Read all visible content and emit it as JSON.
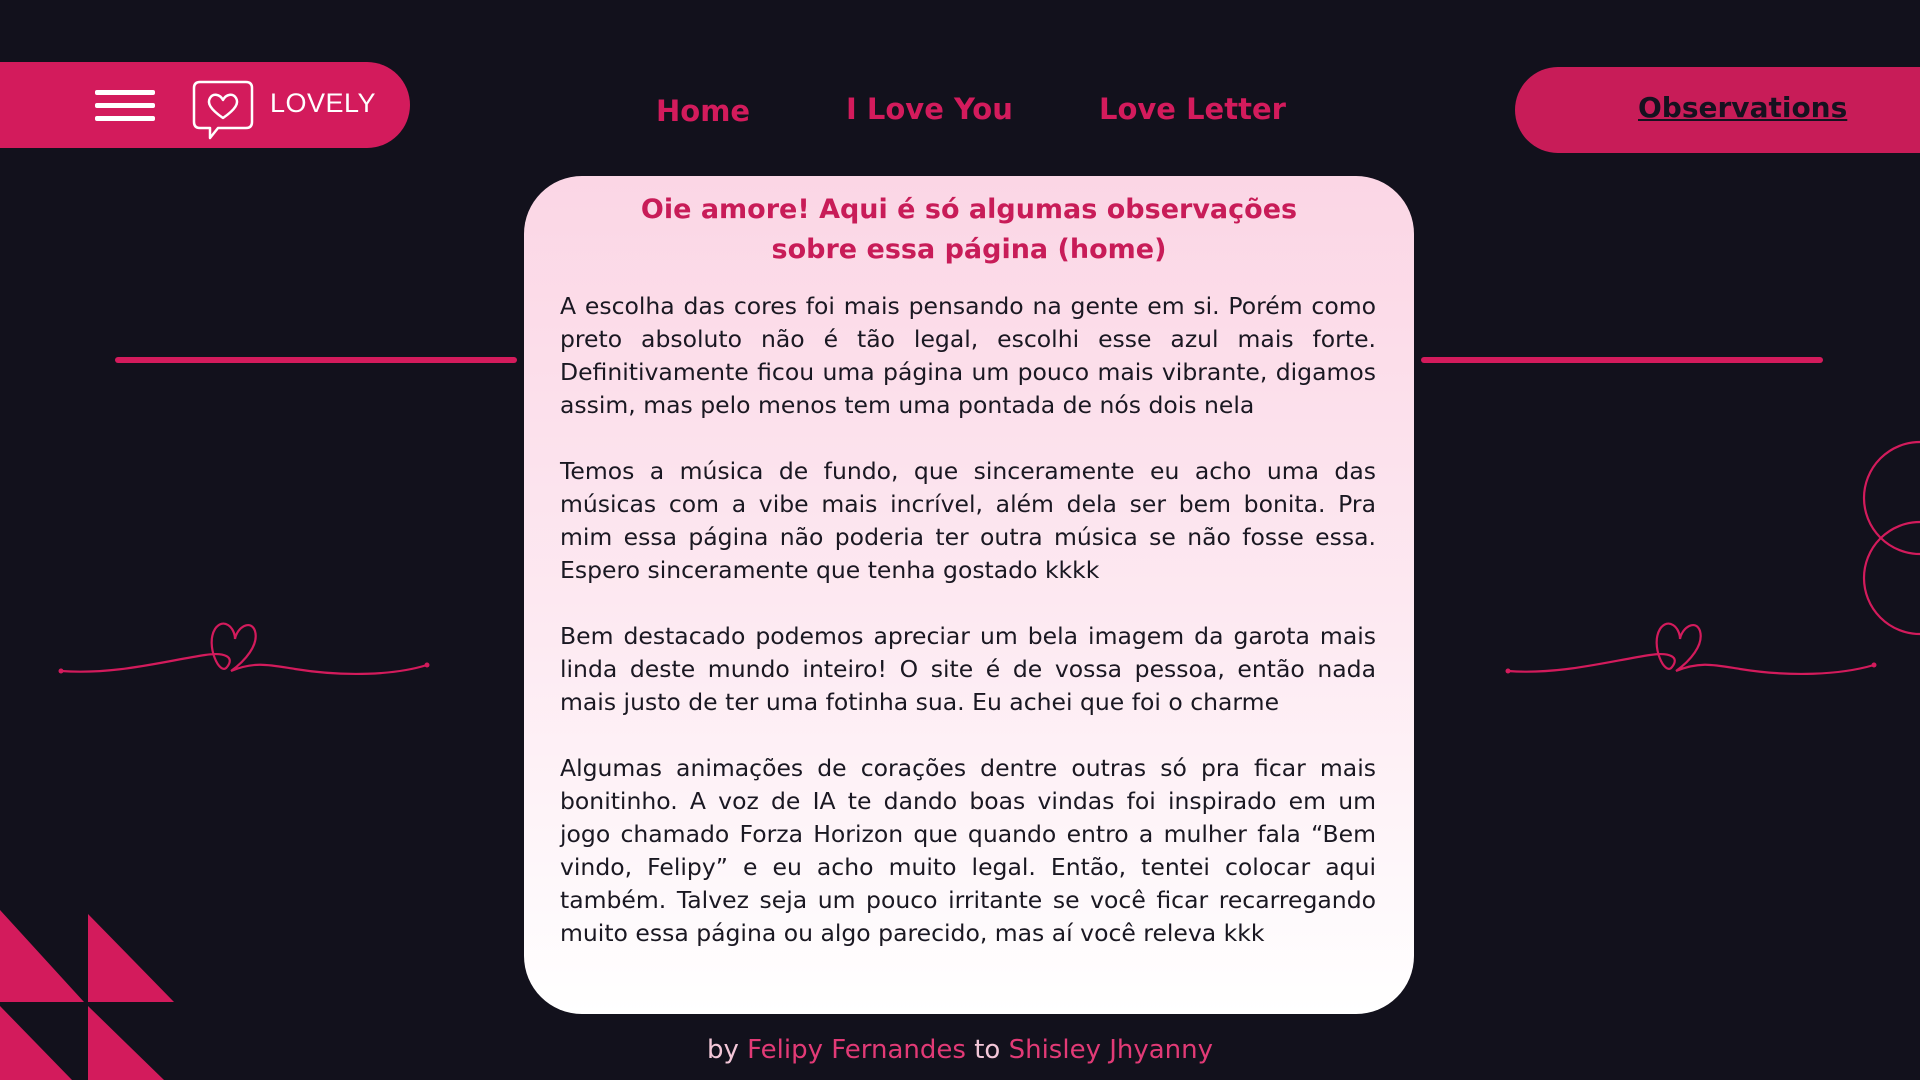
{
  "header": {
    "logo_text": "LOVELY",
    "menu_icon": "hamburger-menu-icon",
    "logo_icon": "heart-chat-bubble-icon"
  },
  "nav": {
    "home": "Home",
    "i_love_you": "I Love You",
    "love_letter": "Love Letter",
    "observations": "Observations"
  },
  "card": {
    "title_line1": "Oie amore! Aqui é só algumas observações",
    "title_line2": "sobre essa página (home)",
    "paragraphs": [
      "A escolha das cores foi mais pensando na gente em si. Porém como preto absoluto não é tão legal, escolhi esse azul mais forte. Definitivamente ficou uma página um pouco mais vibrante, digamos assim, mas pelo menos tem uma pontada de nós dois nela",
      "Temos a música de fundo, que sinceramente eu acho uma das músicas com a vibe mais incrível, além dela ser bem bonita. Pra mim essa página não poderia ter outra música se não fosse essa. Espero sinceramente que tenha gostado kkkk",
      "Bem destacado podemos apreciar um bela imagem da garota mais linda deste mundo inteiro! O site é de vossa pessoa, então nada mais justo de ter uma fotinha sua. Eu achei que foi o charme",
      "Algumas animações de corações dentre outras só pra ficar mais bonitinho. A voz de IA te dando boas vindas foi inspirado em um jogo chamado Forza Horizon que quando entro a mulher fala “Bem vindo, Felipy” e eu acho muito legal. Então, tentei colocar aqui também. Talvez seja um pouco irritante se você ficar recarregando muito essa página ou algo parecido, mas aí você releva kkk"
    ]
  },
  "footer": {
    "by": "by",
    "author": "Felipy Fernandes",
    "to": "to",
    "recipient": "Shisley Jhyanny"
  },
  "colors": {
    "background": "#12111c",
    "accent": "#d31b5c",
    "card_top": "#fbd6e5",
    "card_bottom": "#ffffff"
  }
}
